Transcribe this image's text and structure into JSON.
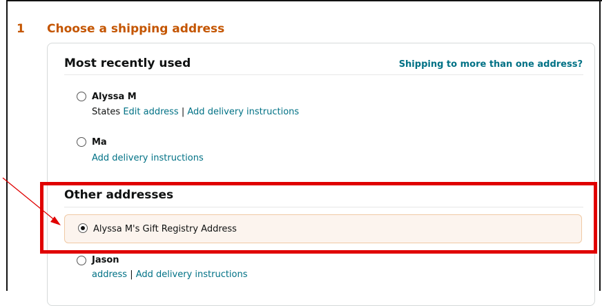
{
  "checkout": {
    "step_number": "1",
    "step_title": "Choose a shipping address",
    "ship_to_multiple": "Shipping to more than one address?",
    "recent_heading": "Most recently used",
    "other_heading": "Other addresses",
    "recent_addresses": [
      {
        "name": "Alyssa M",
        "detail_text": "States",
        "edit_link": "Edit address",
        "separator": "|",
        "delivery_link": "Add delivery instructions",
        "selected": false
      },
      {
        "name": "Ma",
        "delivery_link": "Add delivery instructions",
        "selected": false
      }
    ],
    "other_addresses": [
      {
        "name": "Alyssa M's Gift Registry Address",
        "selected": true
      },
      {
        "name": "Jason",
        "edit_link": "address",
        "separator": "|",
        "delivery_link": "Add delivery instructions",
        "selected": false
      }
    ]
  },
  "colors": {
    "step_title": "#c45500",
    "link": "#007185",
    "highlight_bg": "#fcf4ee",
    "annotation": "#e00000"
  }
}
